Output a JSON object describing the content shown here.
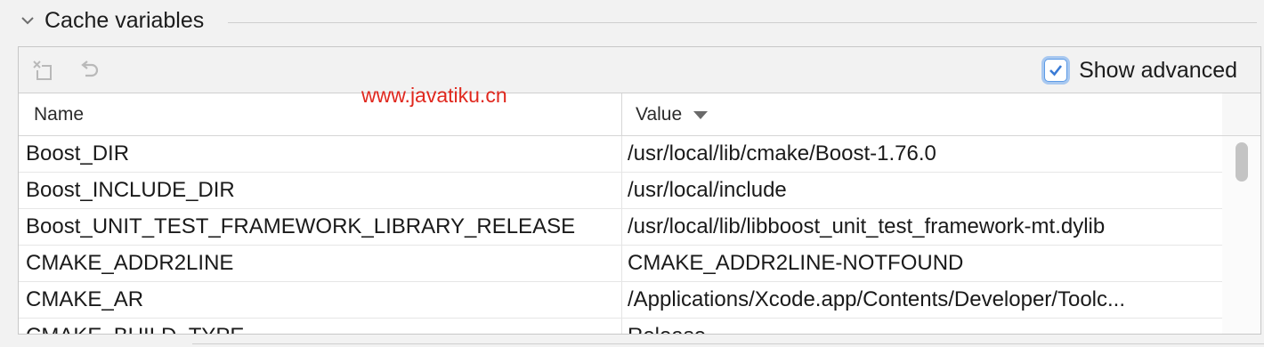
{
  "section": {
    "title": "Cache variables",
    "chevron_icon": "chevron-down-icon"
  },
  "toolbar": {
    "remove_icon": "remove-entry-icon",
    "reset_icon": "undo-icon",
    "show_advanced_label": "Show advanced",
    "show_advanced_checked": true
  },
  "table": {
    "columns": {
      "name": "Name",
      "value": "Value",
      "value_sort_icon": "sort-descending-icon"
    },
    "rows": [
      {
        "name": "Boost_DIR",
        "value": "/usr/local/lib/cmake/Boost-1.76.0"
      },
      {
        "name": "Boost_INCLUDE_DIR",
        "value": "/usr/local/include"
      },
      {
        "name": "Boost_UNIT_TEST_FRAMEWORK_LIBRARY_RELEASE",
        "value": "/usr/local/lib/libboost_unit_test_framework-mt.dylib"
      },
      {
        "name": "CMAKE_ADDR2LINE",
        "value": "CMAKE_ADDR2LINE-NOTFOUND"
      },
      {
        "name": "CMAKE_AR",
        "value": "/Applications/Xcode.app/Contents/Developer/Toolc..."
      },
      {
        "name": "CMAKE_BUILD_TYPE",
        "value": "Release"
      }
    ]
  },
  "watermark": "www.javatiku.cn",
  "colors": {
    "accent": "#5d9be6",
    "watermark": "#e0281e"
  }
}
